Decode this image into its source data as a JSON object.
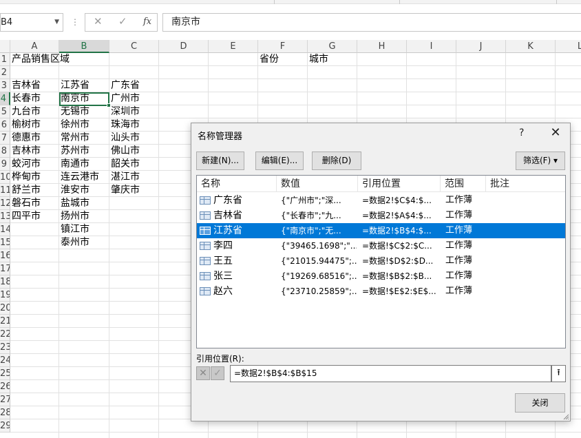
{
  "formula_bar": {
    "name_box": "B4",
    "cancel_icon": "✕",
    "enter_icon": "✓",
    "fx_label": "fx",
    "content": "南京市"
  },
  "sheet": {
    "columns": [
      "A",
      "B",
      "C",
      "D",
      "E",
      "F",
      "G",
      "H",
      "I",
      "J",
      "K",
      "L"
    ],
    "rows": [
      "1",
      "2",
      "3",
      "4",
      "5",
      "6",
      "7",
      "8",
      "9",
      "10",
      "11",
      "12",
      "13",
      "14",
      "15",
      "16",
      "17",
      "18",
      "19",
      "20",
      "21",
      "22",
      "23",
      "24",
      "25",
      "26",
      "27",
      "28",
      "29"
    ],
    "selected_column": "B",
    "selected_row": "4",
    "cells": {
      "A1": "产品销售区域",
      "F1": "省份",
      "G1": "城市",
      "A3": "吉林省",
      "B3": "江苏省",
      "C3": "广东省",
      "A4": "长春市",
      "B4": "南京市",
      "C4": "广州市",
      "A5": "九台市",
      "B5": "无锡市",
      "C5": "深圳市",
      "A6": "榆树市",
      "B6": "徐州市",
      "C6": "珠海市",
      "A7": "德惠市",
      "B7": "常州市",
      "C7": "汕头市",
      "A8": "吉林市",
      "B8": "苏州市",
      "C8": "佛山市",
      "A9": "蛟河市",
      "B9": "南通市",
      "C9": "韶关市",
      "A10": "桦甸市",
      "B10": "连云港市",
      "C10": "湛江市",
      "A11": "舒兰市",
      "B11": "淮安市",
      "C11": "肇庆市",
      "A12": "磐石市",
      "B12": "盐城市",
      "A13": "四平市",
      "B13": "扬州市",
      "B14": "镇江市",
      "B15": "泰州市"
    }
  },
  "dialog": {
    "title": "名称管理器",
    "help": "?",
    "close": "✕",
    "buttons": {
      "new": "新建(N)...",
      "edit": "编辑(E)...",
      "delete": "删除(D)",
      "filter": "筛选(F) ▾",
      "close": "关闭"
    },
    "columns": [
      "名称",
      "数值",
      "引用位置",
      "范围",
      "批注"
    ],
    "names": [
      {
        "name": "广东省",
        "value": "{\"广州市\";\"深...",
        "ref": "=数据2!$C$4:$...",
        "scope": "工作薄",
        "comment": ""
      },
      {
        "name": "吉林省",
        "value": "{\"长春市\";\"九...",
        "ref": "=数据2!$A$4:$...",
        "scope": "工作薄",
        "comment": ""
      },
      {
        "name": "江苏省",
        "value": "{\"南京市\";\"无...",
        "ref": "=数据2!$B$4:$...",
        "scope": "工作薄",
        "comment": ""
      },
      {
        "name": "李四",
        "value": "{\"39465.1698\";\"...",
        "ref": "=数据!$C$2:$C...",
        "scope": "工作薄",
        "comment": ""
      },
      {
        "name": "王五",
        "value": "{\"21015.94475\";...",
        "ref": "=数据!$D$2:$D...",
        "scope": "工作薄",
        "comment": ""
      },
      {
        "name": "张三",
        "value": "{\"19269.68516\";...",
        "ref": "=数据!$B$2:$B...",
        "scope": "工作薄",
        "comment": ""
      },
      {
        "name": "赵六",
        "value": "{\"23710.25859\";...",
        "ref": "=数据!$E$2:$E$...",
        "scope": "工作薄",
        "comment": ""
      }
    ],
    "selected_index": 2,
    "ref_label": "引用位置(R):",
    "ref_value": "=数据2!$B$4:$B$15"
  }
}
